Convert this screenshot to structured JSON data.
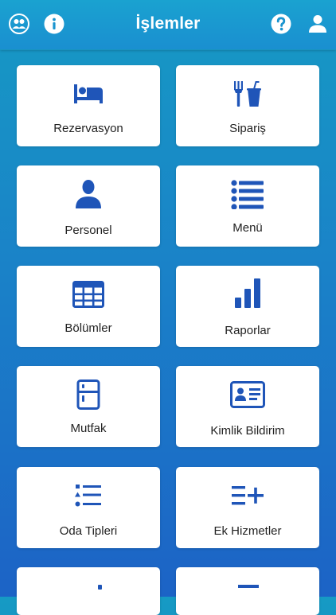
{
  "header": {
    "title": "İşlemler",
    "icons": [
      "users-icon",
      "info-icon",
      "help-icon",
      "user-icon"
    ]
  },
  "colors": {
    "accent": "#1f55b8",
    "header_bg": "#1a9ad0",
    "card_bg": "#ffffff",
    "text": "#222222"
  },
  "menu": {
    "items": [
      {
        "label": "Rezervasyon",
        "icon": "bed-icon"
      },
      {
        "label": "Sipariş",
        "icon": "food-drink-icon"
      },
      {
        "label": "Personel",
        "icon": "person-icon"
      },
      {
        "label": "Menü",
        "icon": "list-icon"
      },
      {
        "label": "Bölümler",
        "icon": "grid-table-icon"
      },
      {
        "label": "Raporlar",
        "icon": "bar-chart-icon"
      },
      {
        "label": "Mutfak",
        "icon": "fridge-icon"
      },
      {
        "label": "Kimlik Bildirim",
        "icon": "id-card-icon"
      },
      {
        "label": "Oda Tipleri",
        "icon": "shapes-list-icon"
      },
      {
        "label": "Ek Hizmetler",
        "icon": "list-add-icon"
      }
    ]
  }
}
